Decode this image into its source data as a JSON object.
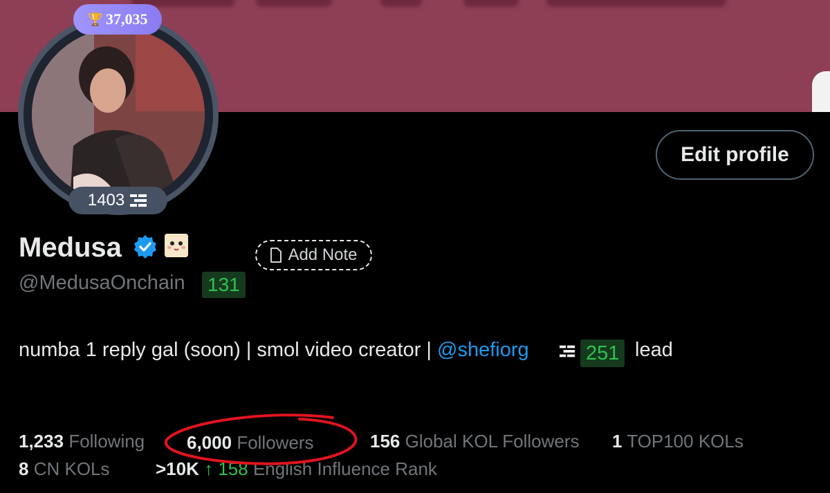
{
  "profile": {
    "score": "37,035",
    "badge_count": "1403",
    "edit_label": "Edit profile",
    "name": "Medusa",
    "add_note_label": "Add Note",
    "handle": "@MedusaOnchain",
    "handle_score": "131"
  },
  "bio": {
    "text_before": "numba 1 reply gal (soon) | smol video creator | ",
    "mention": "@shefiorg",
    "mention_score": "251",
    "text_after": "lead"
  },
  "stats": {
    "following_count": "1,233",
    "following_label": "Following",
    "followers_count": "6,000",
    "followers_label": "Followers",
    "global_kol_count": "156",
    "global_kol_label": "Global KOL Followers",
    "top100_count": "1",
    "top100_label": "TOP100 KOLs",
    "cn_count": "8",
    "cn_label": "CN KOLs",
    "rank_value": ">10K",
    "rank_change": "↑ 158",
    "rank_label": "English Influence Rank"
  },
  "colors": {
    "banner": "#8e3f55",
    "accent_blue": "#1d9bf0",
    "badge_purple": "#9f95ff",
    "positive_green": "#2fc24f",
    "highlight_red": "#e0141e"
  },
  "icons": [
    "trophy-icon",
    "stack-icon",
    "verified-icon",
    "emoji-icon",
    "note-icon"
  ]
}
